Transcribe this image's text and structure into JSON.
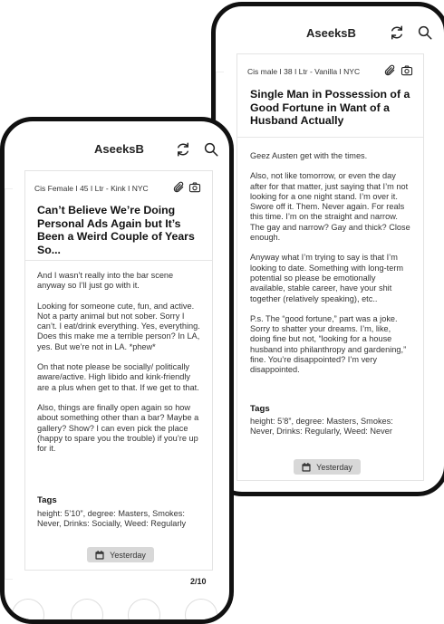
{
  "back": {
    "app_title": "AseeksB",
    "meta": "Cis male  I  38  I  Ltr - Vanilla  I  NYC",
    "headline": "Single Man in Possession of a Good Fortune in Want of a Husband Actually",
    "paragraphs": [
      "Geez Austen get with the times.",
      "Also, not like tomorrow, or even the day after for that matter, just saying that I’m not looking for a one night stand. I’m over it. Swore off it. Them. Never again. For reals this time. I’m on the straight and narrow. The gay and narrow? Gay and thick? Close enough.",
      "Anyway what I’m trying to say is that I’m looking to date. Something with long-term potential so please be emotionally available, stable career, have your shit together (relatively speaking), etc..",
      "P.s. The “good fortune,” part was a joke. Sorry to shatter your dreams. I’m, like, doing fine but not, “looking for a house husband into philanthropy and gardening,” fine. You’re disappointed? I’m very disappointed."
    ],
    "tags_title": "Tags",
    "tags_text": "height: 5’8”, degree: Masters, Smokes: Never, Drinks: Regularly, Weed: Never",
    "time_label": "Yesterday"
  },
  "front": {
    "app_title": "AseeksB",
    "meta": "Cis Female  I  45  I  Ltr - Kink  I  NYC",
    "headline": "Can’t Believe We’re Doing Personal Ads Again but It’s Been a Weird Couple of Years So...",
    "paragraphs": [
      "And I wasn’t really into the bar scene anyway so I’ll just go with it.",
      "Looking for someone cute, fun, and active. Not a party animal but not sober. Sorry I can’t. I eat/drink everything. Yes, everything.  Does this make me a terrible person? In LA, yes. But we’re not in LA. *phew*",
      "On that note please be socially/ politically aware/active. High libido and kink-friendly are a plus when get to that. If we get to that.",
      "Also, things are finally open again so how about  something other than a bar? Maybe a gallery? Show? I can even pick the place (happy to spare you the trouble) if you’re up for it."
    ],
    "tags_title": "Tags",
    "tags_text": "height: 5’10”, degree: Masters, Smokes: Never, Drinks: Socially, Weed: Regularly",
    "time_label": "Yesterday",
    "pager": "2/10"
  },
  "icons": {
    "refresh": "refresh-icon",
    "search": "search-icon",
    "attachment": "paperclip-icon",
    "camera": "camera-icon",
    "calendar": "calendar-icon"
  },
  "colors": {
    "frame": "#111111",
    "time_badge": "#d8d8d8",
    "divider": "#e6e6e6"
  }
}
